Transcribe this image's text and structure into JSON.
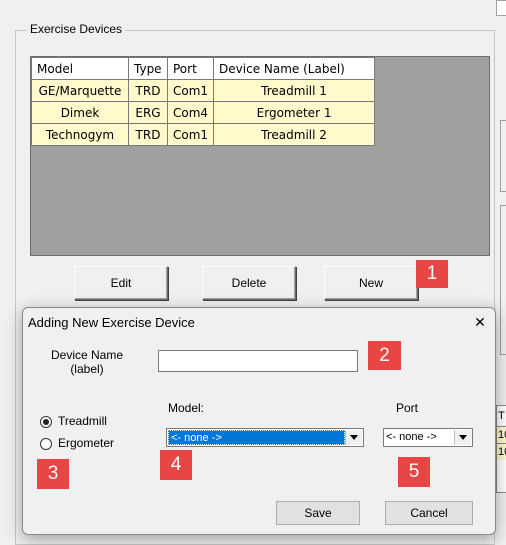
{
  "group": {
    "title": "Exercise Devices"
  },
  "table": {
    "headers": [
      "Model",
      "Type",
      "Port",
      "Device Name (Label)"
    ],
    "rows": [
      [
        "GE/Marquette",
        "TRD",
        "Com1",
        "Treadmill 1"
      ],
      [
        "Dimek",
        "ERG",
        "Com4",
        "Ergometer 1"
      ],
      [
        "Technogym",
        "TRD",
        "Com1",
        "Treadmill 2"
      ]
    ]
  },
  "buttons": {
    "edit": "Edit",
    "delete": "Delete",
    "new": "New"
  },
  "dialog": {
    "title": "Adding New Exercise Device",
    "close_glyph": "✕",
    "device_name_label_line1": "Device Name",
    "device_name_label_line2": "(label)",
    "device_name_value": "",
    "radio_treadmill": "Treadmill",
    "radio_ergometer": "Ergometer",
    "model_label": "Model:",
    "model_value": "<- none ->",
    "port_label": "Port",
    "port_value": "<- none ->",
    "save": "Save",
    "cancel": "Cancel"
  },
  "badges": [
    "1",
    "2",
    "3",
    "4",
    "5"
  ],
  "background_right": {
    "col_header": "T",
    "row1": "10",
    "row2": "10"
  },
  "colors": {
    "badge": "#e84545",
    "grid_bg": "#a0a0a0",
    "row_bg": "#fff9cc",
    "selection": "#0078d7"
  }
}
